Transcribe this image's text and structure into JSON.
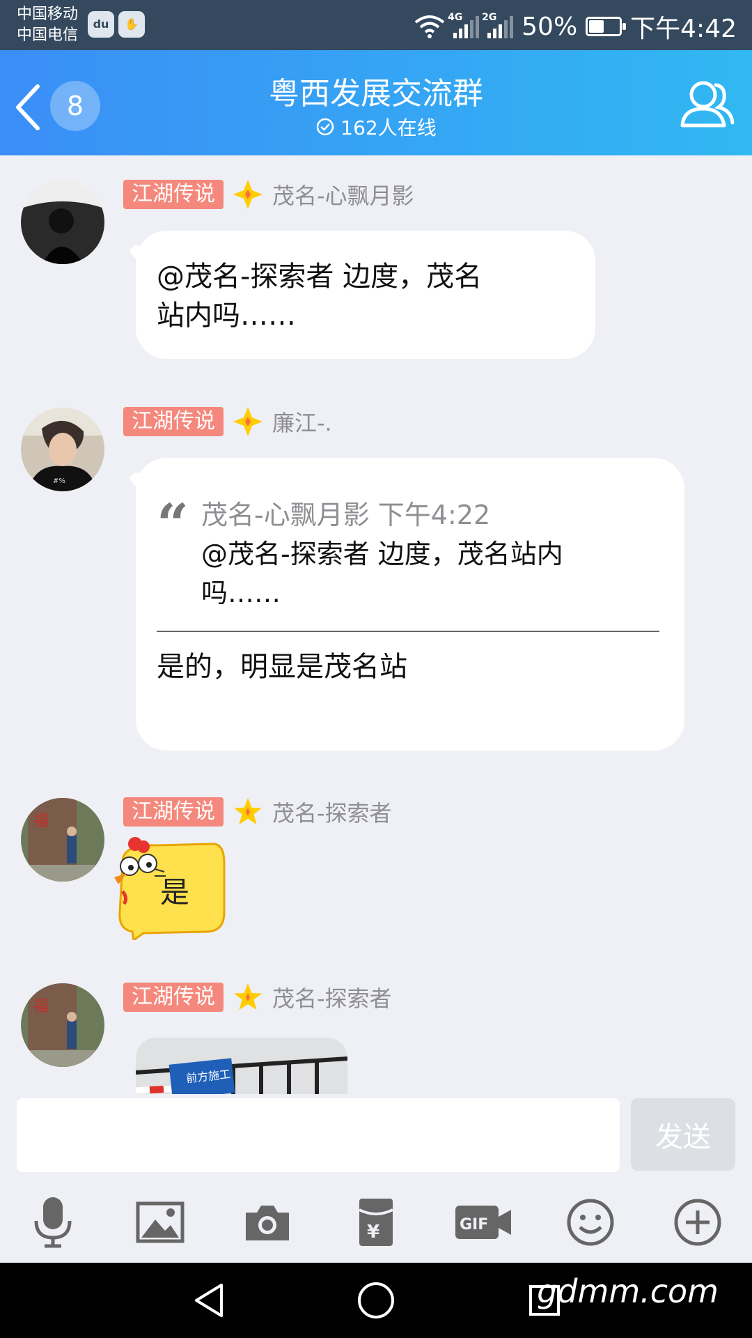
{
  "status_bar": {
    "carrier_1": "中国移动",
    "carrier_2": "中国电信",
    "app_icon_1": "baidu-icon",
    "app_icon_2": "shield-hand-icon",
    "network_1": "4G",
    "network_2": "2G",
    "battery_percent": "50%",
    "battery_level": 0.5,
    "time": "下午4:42"
  },
  "header": {
    "back_icon": "chevron-left-icon",
    "unread_count": "8",
    "title": "粤西发展交流群",
    "online_count": "162人在线",
    "members_icon": "members-icon"
  },
  "messages": [
    {
      "title_badge": "江湖传说",
      "nickname": "茂名-心飘月影",
      "text_lines": [
        "@茂名-探索者 边度，茂名",
        "站内吗……"
      ]
    },
    {
      "title_badge": "江湖传说",
      "nickname": "廉江-.",
      "quote": {
        "author_time": "茂名-心飘月影 下午4:22",
        "lines": [
          "@茂名-探索者 边度，茂名站内",
          "吗……"
        ]
      },
      "text": "是的，明显是茂名站"
    },
    {
      "title_badge": "江湖传说",
      "nickname": "茂名-探索者",
      "sticker_text": "是"
    },
    {
      "title_badge": "江湖传说",
      "nickname": "茂名-探索者",
      "image_sign_text": "前方施工"
    }
  ],
  "composer": {
    "input_value": "",
    "input_placeholder": "",
    "send_label": "发送"
  },
  "toolbar": [
    "microphone-icon",
    "image-icon",
    "camera-icon",
    "red-packet-icon",
    "gif-icon",
    "emoji-icon",
    "plus-icon"
  ],
  "navbar": {
    "watermark": "gdmm.com"
  },
  "colors": {
    "header_gradient_start": "#3a8ef6",
    "header_gradient_end": "#31b8f2",
    "badge": "#f5887c",
    "send_disabled": "#dcdfe4"
  }
}
